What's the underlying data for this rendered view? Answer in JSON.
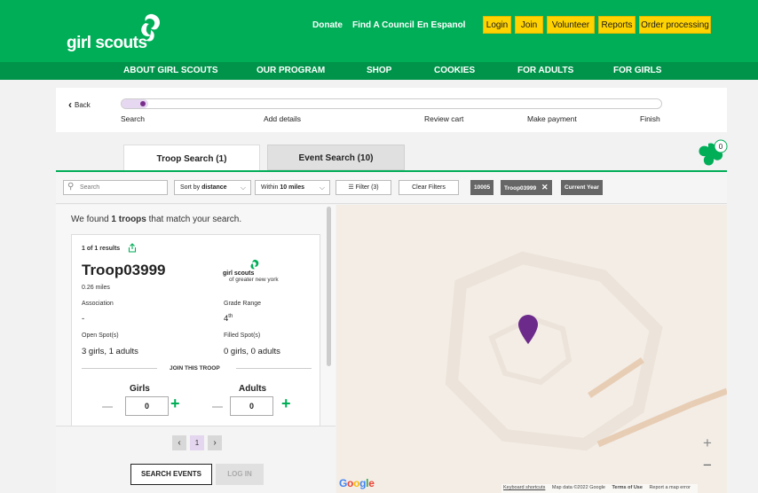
{
  "header": {
    "logo_text": "girl scouts",
    "links": [
      "Donate",
      "Find A Council",
      "En Espanol"
    ],
    "buttons": [
      "Login",
      "Join",
      "Volunteer",
      "Reports",
      "Order processing"
    ]
  },
  "nav": [
    "ABOUT GIRL SCOUTS",
    "OUR PROGRAM",
    "SHOP",
    "COOKIES",
    "FOR ADULTS",
    "FOR GIRLS"
  ],
  "progress": {
    "back_label": "Back",
    "steps": [
      "Search",
      "Add details",
      "Review cart",
      "Make payment",
      "Finish"
    ],
    "current_step": 1
  },
  "tabs": {
    "troop": "Troop Search (1)",
    "event": "Event Search (10)"
  },
  "cart": {
    "count": "0"
  },
  "filters": {
    "search_placeholder": "Search",
    "sort_prefix": "Sort by ",
    "sort_value": "distance",
    "radius_prefix": "Within ",
    "radius_value": "10 miles",
    "filter_label": "Filter (3)",
    "clear_label": "Clear Filters",
    "chips": [
      "10005",
      "Troop03999",
      "Current Year"
    ]
  },
  "results": {
    "found_prefix": "We found ",
    "found_count": "1 troops",
    "found_suffix": " that match your search.",
    "card": {
      "result_count": "1 of 1 results",
      "name": "Troop03999",
      "distance": "0.26 miles",
      "council_logo_text": "girl scouts",
      "council_logo_sub": "of greater new york",
      "association_label": "Association",
      "association_value": "-",
      "grade_label": "Grade Range",
      "grade_value": "4",
      "grade_suffix": "th",
      "open_label": "Open Spot(s)",
      "open_value": "3 girls, 1 adults",
      "filled_label": "Filled Spot(s)",
      "filled_value": "0 girls, 0 adults",
      "join_label": "JOIN THIS TROOP",
      "girls_label": "Girls",
      "girls_count": "0",
      "adults_label": "Adults",
      "adults_count": "0"
    }
  },
  "pagination": {
    "prev": "‹",
    "page": "1",
    "next": "›"
  },
  "actions": {
    "search_events": "SEARCH EVENTS",
    "login": "LOG IN"
  },
  "map": {
    "google": "Google",
    "zoom_in": "+",
    "zoom_out": "−",
    "footer": [
      "Keyboard shortcuts",
      "Map data ©2022 Google",
      "Terms of Use",
      "Report a map error"
    ]
  },
  "colors": {
    "brand_green": "#00ae58",
    "nav_green": "#00944a",
    "accent_yellow": "#ffd200",
    "pin_purple": "#6c2a8b"
  },
  "icons": [
    "girl-scouts-trefoil-icon",
    "chevron-left-icon",
    "search-icon",
    "chevron-down-icon",
    "filter-icon",
    "close-icon",
    "share-icon",
    "cart-trefoil-icon",
    "map-pin-icon"
  ]
}
